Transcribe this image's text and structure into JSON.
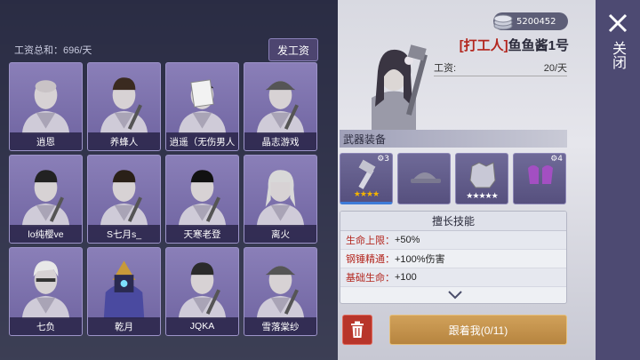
{
  "wages": {
    "total_label": "工资总和：696/天",
    "pay_button": "发工资"
  },
  "roster": [
    {
      "name": "逍恩",
      "hair": "#1a1a1a",
      "style": "bald"
    },
    {
      "name": "养蜂人",
      "hair": "#3a2a20",
      "style": "short"
    },
    {
      "name": "逍遥（无伤男人",
      "hair": "#2a2a2a",
      "style": "paper"
    },
    {
      "name": "晶志游戏",
      "hair": "#333",
      "style": "cap"
    },
    {
      "name": "lo纯樱ve",
      "hair": "#222",
      "style": "short"
    },
    {
      "name": "S七月s_",
      "hair": "#2a2018",
      "style": "short"
    },
    {
      "name": "天寒老登",
      "hair": "#111",
      "style": "short"
    },
    {
      "name": "离火",
      "hair": "#d8d8d8",
      "style": "long"
    },
    {
      "name": "七负",
      "hair": "#e8e8e8",
      "style": "light"
    },
    {
      "name": "乾月",
      "hair": "#c89a3a",
      "style": "mech"
    },
    {
      "name": "JQKA",
      "hair": "#2a2a2a",
      "style": "short"
    },
    {
      "name": "雪落棠纱",
      "hair": "#222",
      "style": "cap"
    }
  ],
  "currency": {
    "amount": "5200452"
  },
  "character": {
    "tag": "[打工人]",
    "name": "鱼鱼酱1号",
    "wage_label": "工资:",
    "wage_value": "20/天"
  },
  "equipment": {
    "title": "武器装备",
    "slots": [
      {
        "icon": "hammer-icon",
        "level": "3",
        "stars": 4,
        "selected": true
      },
      {
        "icon": "cap-icon",
        "level": "",
        "stars": 0,
        "selected": false
      },
      {
        "icon": "armor-icon",
        "level": "",
        "stars": 5,
        "selected": false
      },
      {
        "icon": "gloves-icon",
        "level": "4",
        "stars": 0,
        "selected": false
      }
    ]
  },
  "skills": {
    "title": "擅长技能",
    "items": [
      {
        "name": "生命上限：",
        "value": "+50%"
      },
      {
        "name": "钢锤精通：",
        "value": "+100%伤害"
      },
      {
        "name": "基础生命：",
        "value": "+100"
      }
    ]
  },
  "actions": {
    "follow_label": "跟着我(0/11)",
    "close_label": "关闭"
  },
  "colors": {
    "accent_red": "#b3261e",
    "follow_gold": "#c4924c",
    "card_purple": "#7a70ac"
  }
}
